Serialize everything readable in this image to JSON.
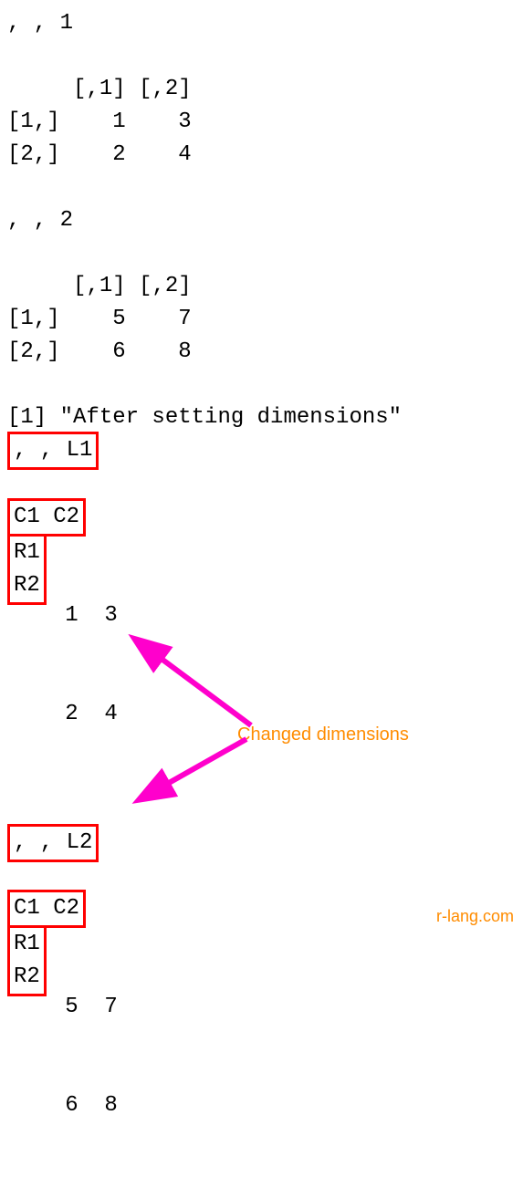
{
  "before": {
    "slice1_header": ", , 1",
    "colhdr": "     [,1] [,2]",
    "row1": "[1,]    1    3",
    "row2": "[2,]    2    4",
    "slice2_header": ", , 2",
    "row3": "[1,]    5    7",
    "row4": "[2,]    6    8"
  },
  "message": "[1] \"After setting dimensions\"",
  "after": {
    "slice1_header": ", , L1",
    "colhdr": "   C1 C2",
    "row1_label": "R1",
    "row2_label": "R2",
    "row1_vals": " 1  3",
    "row2_vals": " 2  4",
    "slice2_header": ", , L2",
    "row3_vals": " 5  7",
    "row4_vals": " 6  8"
  },
  "annotation": "Changed dimensions",
  "watermark": "r-lang.com",
  "chart_data": {
    "type": "table",
    "description": "R console output showing a 3D array printed before and after setting dimnames",
    "array_dim": [
      2,
      2,
      2
    ],
    "values": [
      [
        [
          1,
          3
        ],
        [
          2,
          4
        ]
      ],
      [
        [
          5,
          7
        ],
        [
          6,
          8
        ]
      ]
    ],
    "before_dimnames": null,
    "after_dimnames": {
      "rows": [
        "R1",
        "R2"
      ],
      "cols": [
        "C1",
        "C2"
      ],
      "layers": [
        "L1",
        "L2"
      ]
    }
  }
}
